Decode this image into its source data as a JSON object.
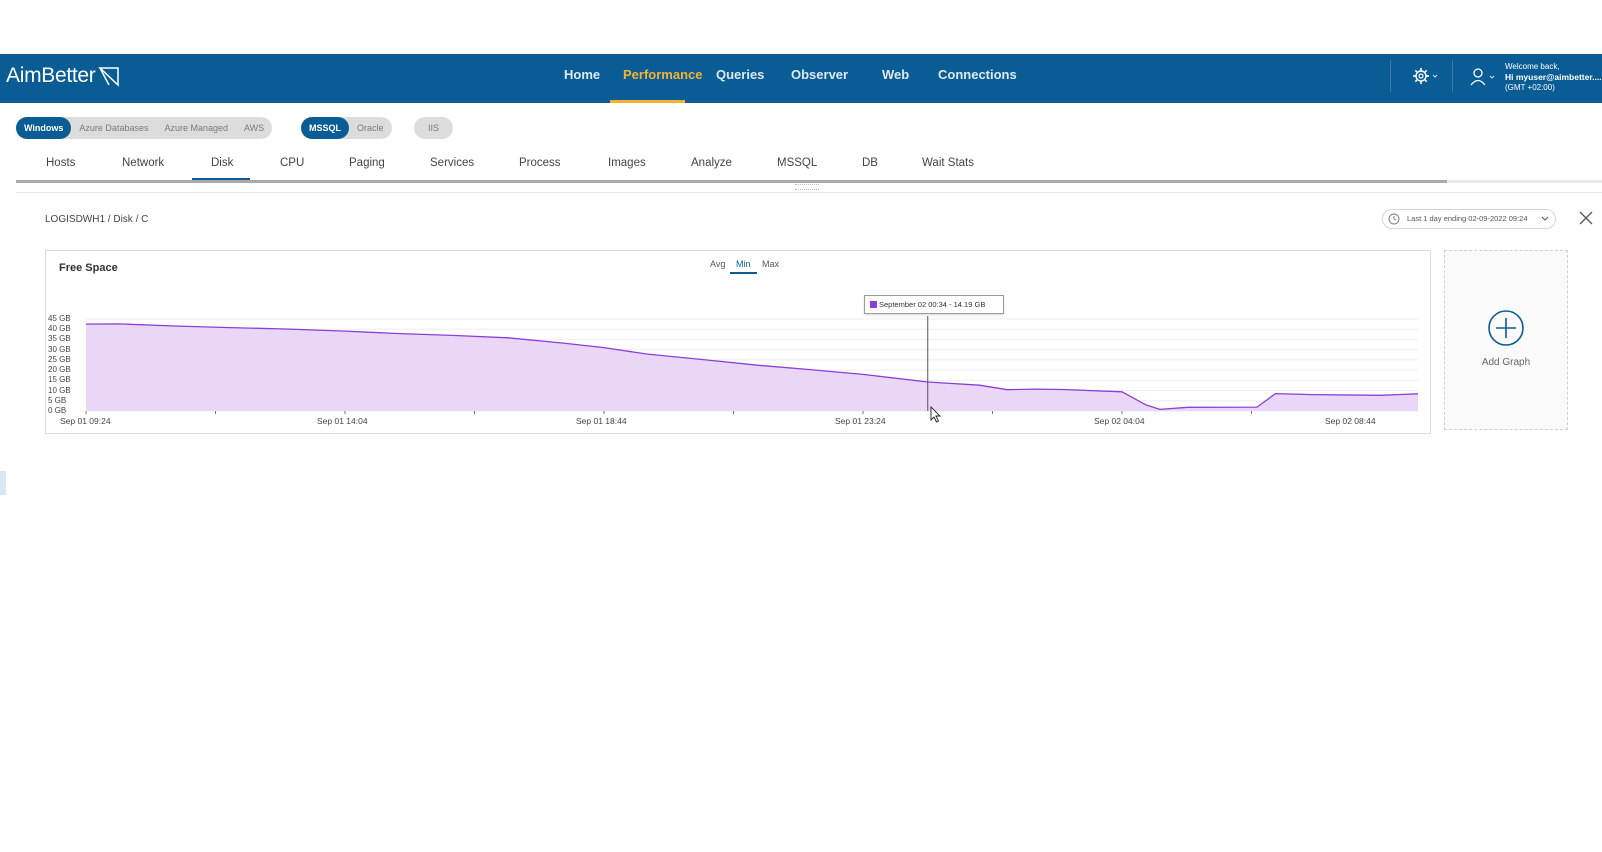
{
  "app": {
    "brand": "AimBetter",
    "nav": [
      {
        "label": "Home",
        "active": false
      },
      {
        "label": "Performance",
        "active": true
      },
      {
        "label": "Queries",
        "active": false
      },
      {
        "label": "Observer",
        "active": false
      },
      {
        "label": "Web",
        "active": false
      },
      {
        "label": "Connections",
        "active": false
      }
    ],
    "user": {
      "welcome": "Welcome back,",
      "name": "Hi myuser@aimbetter....",
      "timezone": "(GMT +02:00)"
    },
    "colors": {
      "nav_bg": "#0a5c94",
      "accent": "#f5b335",
      "series": "#8a3fd6"
    }
  },
  "filters": {
    "platforms": [
      {
        "label": "Windows",
        "selected": true
      },
      {
        "label": "Azure Databases",
        "selected": false
      },
      {
        "label": "Azure Managed",
        "selected": false
      },
      {
        "label": "AWS",
        "selected": false
      }
    ],
    "db_engines": [
      {
        "label": "MSSQL",
        "selected": true
      },
      {
        "label": "Oracle",
        "selected": false
      }
    ],
    "web": [
      {
        "label": "IIS",
        "selected": false
      }
    ]
  },
  "tabs": [
    {
      "label": "Hosts",
      "active": false
    },
    {
      "label": "Network",
      "active": false
    },
    {
      "label": "Disk",
      "active": true
    },
    {
      "label": "CPU",
      "active": false
    },
    {
      "label": "Paging",
      "active": false
    },
    {
      "label": "Services",
      "active": false
    },
    {
      "label": "Process",
      "active": false
    },
    {
      "label": "Images",
      "active": false
    },
    {
      "label": "Analyze",
      "active": false
    },
    {
      "label": "MSSQL",
      "active": false
    },
    {
      "label": "DB",
      "active": false
    },
    {
      "label": "Wait Stats",
      "active": false
    }
  ],
  "panel": {
    "breadcrumb": "LOGISDWH1 / Disk / C",
    "time_range": "Last 1 day ending  02-09-2022 09:24",
    "add_graph_label": "Add Graph",
    "aggregations": [
      {
        "label": "Avg",
        "selected": false
      },
      {
        "label": "Min",
        "selected": true
      },
      {
        "label": "Max",
        "selected": false
      }
    ],
    "tooltip": "September 02 00:34 - 14.19 GB"
  },
  "chart_data": {
    "type": "area",
    "title": "Free Space",
    "ylabel": "",
    "xlabel": "",
    "y_ticks": [
      "45 GB",
      "40 GB",
      "35 GB",
      "30 GB",
      "25 GB",
      "20 GB",
      "15 GB",
      "10 GB",
      "5 GB",
      "0 GB"
    ],
    "ylim": [
      0,
      45
    ],
    "x_ticks": [
      "Sep 01 09:24",
      "Sep 01 14:04",
      "Sep 01 18:44",
      "Sep 01 23:24",
      "Sep 02 04:04",
      "Sep 02 08:44"
    ],
    "grid": true,
    "series": [
      {
        "unit": "GB",
        "color": "#8a3fd6",
        "points": [
          [
            "Sep 01 09:24",
            42.5
          ],
          [
            "Sep 01 10:00",
            42.6
          ],
          [
            "Sep 01 11:00",
            41.6
          ],
          [
            "Sep 01 12:00",
            40.8
          ],
          [
            "Sep 01 13:00",
            40.1
          ],
          [
            "Sep 01 14:04",
            39.1
          ],
          [
            "Sep 01 15:00",
            37.9
          ],
          [
            "Sep 01 16:00",
            37.0
          ],
          [
            "Sep 01 17:00",
            35.8
          ],
          [
            "Sep 01 18:00",
            33.2
          ],
          [
            "Sep 01 18:44",
            31.0
          ],
          [
            "Sep 01 19:30",
            27.9
          ],
          [
            "Sep 01 20:30",
            25.2
          ],
          [
            "Sep 01 21:30",
            22.4
          ],
          [
            "Sep 01 22:30",
            20.1
          ],
          [
            "Sep 01 23:24",
            17.9
          ],
          [
            "Sep 02 00:34",
            14.19
          ],
          [
            "Sep 02 01:30",
            12.6
          ],
          [
            "Sep 02 02:00",
            10.4
          ],
          [
            "Sep 02 02:30",
            10.7
          ],
          [
            "Sep 02 03:00",
            10.5
          ],
          [
            "Sep 02 04:04",
            9.4
          ],
          [
            "Sep 02 04:30",
            3.0
          ],
          [
            "Sep 02 04:45",
            0.8
          ],
          [
            "Sep 02 05:15",
            1.8
          ],
          [
            "Sep 02 06:30",
            1.9
          ],
          [
            "Sep 02 06:50",
            8.5
          ],
          [
            "Sep 02 07:30",
            8.0
          ],
          [
            "Sep 02 08:44",
            7.7
          ],
          [
            "Sep 02 09:24",
            8.4
          ]
        ]
      }
    ]
  }
}
